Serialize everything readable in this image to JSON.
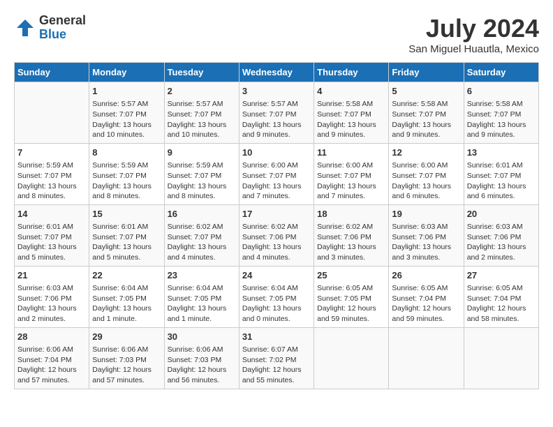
{
  "logo": {
    "line1": "General",
    "line2": "Blue"
  },
  "title": "July 2024",
  "location": "San Miguel Huautla, Mexico",
  "days_header": [
    "Sunday",
    "Monday",
    "Tuesday",
    "Wednesday",
    "Thursday",
    "Friday",
    "Saturday"
  ],
  "weeks": [
    [
      {
        "day": "",
        "info": ""
      },
      {
        "day": "1",
        "info": "Sunrise: 5:57 AM\nSunset: 7:07 PM\nDaylight: 13 hours\nand 10 minutes."
      },
      {
        "day": "2",
        "info": "Sunrise: 5:57 AM\nSunset: 7:07 PM\nDaylight: 13 hours\nand 10 minutes."
      },
      {
        "day": "3",
        "info": "Sunrise: 5:57 AM\nSunset: 7:07 PM\nDaylight: 13 hours\nand 9 minutes."
      },
      {
        "day": "4",
        "info": "Sunrise: 5:58 AM\nSunset: 7:07 PM\nDaylight: 13 hours\nand 9 minutes."
      },
      {
        "day": "5",
        "info": "Sunrise: 5:58 AM\nSunset: 7:07 PM\nDaylight: 13 hours\nand 9 minutes."
      },
      {
        "day": "6",
        "info": "Sunrise: 5:58 AM\nSunset: 7:07 PM\nDaylight: 13 hours\nand 9 minutes."
      }
    ],
    [
      {
        "day": "7",
        "info": "Sunrise: 5:59 AM\nSunset: 7:07 PM\nDaylight: 13 hours\nand 8 minutes."
      },
      {
        "day": "8",
        "info": "Sunrise: 5:59 AM\nSunset: 7:07 PM\nDaylight: 13 hours\nand 8 minutes."
      },
      {
        "day": "9",
        "info": "Sunrise: 5:59 AM\nSunset: 7:07 PM\nDaylight: 13 hours\nand 8 minutes."
      },
      {
        "day": "10",
        "info": "Sunrise: 6:00 AM\nSunset: 7:07 PM\nDaylight: 13 hours\nand 7 minutes."
      },
      {
        "day": "11",
        "info": "Sunrise: 6:00 AM\nSunset: 7:07 PM\nDaylight: 13 hours\nand 7 minutes."
      },
      {
        "day": "12",
        "info": "Sunrise: 6:00 AM\nSunset: 7:07 PM\nDaylight: 13 hours\nand 6 minutes."
      },
      {
        "day": "13",
        "info": "Sunrise: 6:01 AM\nSunset: 7:07 PM\nDaylight: 13 hours\nand 6 minutes."
      }
    ],
    [
      {
        "day": "14",
        "info": "Sunrise: 6:01 AM\nSunset: 7:07 PM\nDaylight: 13 hours\nand 5 minutes."
      },
      {
        "day": "15",
        "info": "Sunrise: 6:01 AM\nSunset: 7:07 PM\nDaylight: 13 hours\nand 5 minutes."
      },
      {
        "day": "16",
        "info": "Sunrise: 6:02 AM\nSunset: 7:07 PM\nDaylight: 13 hours\nand 4 minutes."
      },
      {
        "day": "17",
        "info": "Sunrise: 6:02 AM\nSunset: 7:06 PM\nDaylight: 13 hours\nand 4 minutes."
      },
      {
        "day": "18",
        "info": "Sunrise: 6:02 AM\nSunset: 7:06 PM\nDaylight: 13 hours\nand 3 minutes."
      },
      {
        "day": "19",
        "info": "Sunrise: 6:03 AM\nSunset: 7:06 PM\nDaylight: 13 hours\nand 3 minutes."
      },
      {
        "day": "20",
        "info": "Sunrise: 6:03 AM\nSunset: 7:06 PM\nDaylight: 13 hours\nand 2 minutes."
      }
    ],
    [
      {
        "day": "21",
        "info": "Sunrise: 6:03 AM\nSunset: 7:06 PM\nDaylight: 13 hours\nand 2 minutes."
      },
      {
        "day": "22",
        "info": "Sunrise: 6:04 AM\nSunset: 7:05 PM\nDaylight: 13 hours\nand 1 minute."
      },
      {
        "day": "23",
        "info": "Sunrise: 6:04 AM\nSunset: 7:05 PM\nDaylight: 13 hours\nand 1 minute."
      },
      {
        "day": "24",
        "info": "Sunrise: 6:04 AM\nSunset: 7:05 PM\nDaylight: 13 hours\nand 0 minutes."
      },
      {
        "day": "25",
        "info": "Sunrise: 6:05 AM\nSunset: 7:05 PM\nDaylight: 12 hours\nand 59 minutes."
      },
      {
        "day": "26",
        "info": "Sunrise: 6:05 AM\nSunset: 7:04 PM\nDaylight: 12 hours\nand 59 minutes."
      },
      {
        "day": "27",
        "info": "Sunrise: 6:05 AM\nSunset: 7:04 PM\nDaylight: 12 hours\nand 58 minutes."
      }
    ],
    [
      {
        "day": "28",
        "info": "Sunrise: 6:06 AM\nSunset: 7:04 PM\nDaylight: 12 hours\nand 57 minutes."
      },
      {
        "day": "29",
        "info": "Sunrise: 6:06 AM\nSunset: 7:03 PM\nDaylight: 12 hours\nand 57 minutes."
      },
      {
        "day": "30",
        "info": "Sunrise: 6:06 AM\nSunset: 7:03 PM\nDaylight: 12 hours\nand 56 minutes."
      },
      {
        "day": "31",
        "info": "Sunrise: 6:07 AM\nSunset: 7:02 PM\nDaylight: 12 hours\nand 55 minutes."
      },
      {
        "day": "",
        "info": ""
      },
      {
        "day": "",
        "info": ""
      },
      {
        "day": "",
        "info": ""
      }
    ]
  ]
}
